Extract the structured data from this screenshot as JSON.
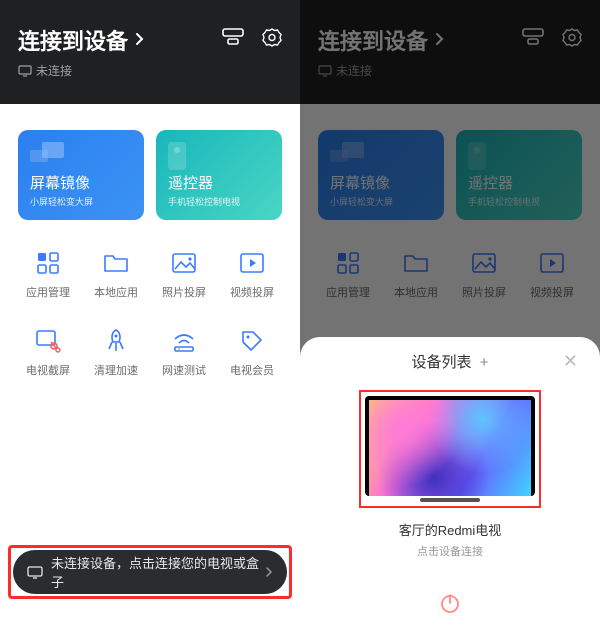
{
  "left": {
    "header": {
      "title": "连接到设备",
      "status": "未连接"
    },
    "cards": [
      {
        "title": "屏幕镜像",
        "subtitle": "小屏轻松变大屏"
      },
      {
        "title": "遥控器",
        "subtitle": "手机轻松控制电视"
      }
    ],
    "grid": [
      {
        "id": "apps",
        "label": "应用管理"
      },
      {
        "id": "local",
        "label": "本地应用"
      },
      {
        "id": "photo",
        "label": "照片投屏"
      },
      {
        "id": "video",
        "label": "视频投屏"
      },
      {
        "id": "shot",
        "label": "电视截屏"
      },
      {
        "id": "clean",
        "label": "清理加速"
      },
      {
        "id": "speed",
        "label": "网速测试"
      },
      {
        "id": "vip",
        "label": "电视会员"
      }
    ],
    "connect_bar": "未连接设备，点击连接您的电视或盒子"
  },
  "right": {
    "header": {
      "title": "连接到设备",
      "status": "未连接"
    },
    "cards": [
      {
        "title": "屏幕镜像",
        "subtitle": "小屏轻松变大屏"
      },
      {
        "title": "遥控器",
        "subtitle": "手机轻松控制电视"
      }
    ],
    "grid": [
      {
        "id": "apps",
        "label": "应用管理"
      },
      {
        "id": "local",
        "label": "本地应用"
      },
      {
        "id": "photo",
        "label": "照片投屏"
      },
      {
        "id": "video",
        "label": "视频投屏"
      }
    ],
    "panel": {
      "title": "设备列表",
      "device_name": "客厅的Redmi电视",
      "device_hint": "点击设备连接"
    }
  }
}
